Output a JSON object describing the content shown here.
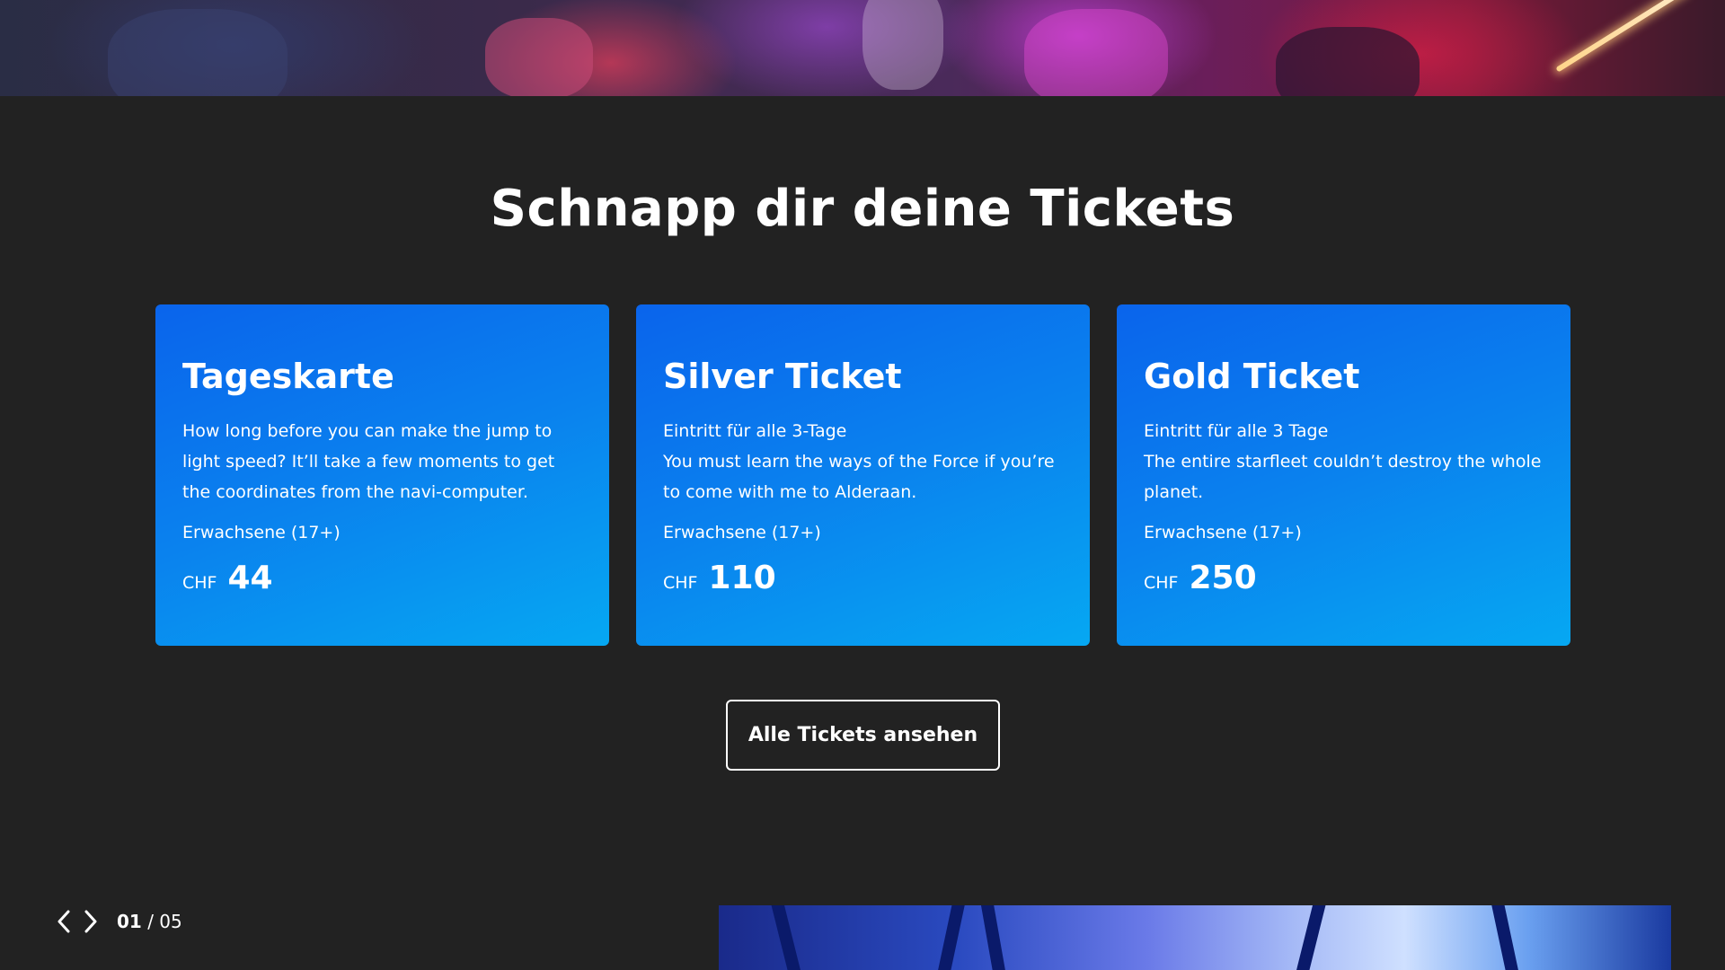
{
  "headline": "Schnapp dir deine Tickets",
  "tickets": [
    {
      "title": "Tageskarte",
      "description": "How long before you can make the jump to light speed? It’ll take a few moments to get the coordinates from the navi-computer.",
      "age": "Erwachsene (17+)",
      "currency": "CHF",
      "price": "44"
    },
    {
      "title": "Silver Ticket",
      "description_line1": "Eintritt für alle 3-Tage",
      "description": "You must learn the ways of the Force if you’re to come with me to Alderaan.",
      "age": "Erwachsene (17+)",
      "currency": "CHF",
      "price": "110"
    },
    {
      "title": "Gold Ticket",
      "description_line1": "Eintritt für alle 3 Tage",
      "description": "The entire starfleet couldn’t destroy the whole planet.",
      "age": "Erwachsene (17+)",
      "currency": "CHF",
      "price": "250"
    }
  ],
  "all_tickets_button": "Alle Tickets ansehen",
  "pager": {
    "current": "01",
    "separator": " / ",
    "total": "05",
    "prev_icon": "chevron-left-icon",
    "next_icon": "chevron-right-icon"
  },
  "colors": {
    "background": "#222222",
    "card_gradient_start": "#0a64ec",
    "card_gradient_end": "#06a8f2",
    "text": "#ffffff"
  }
}
